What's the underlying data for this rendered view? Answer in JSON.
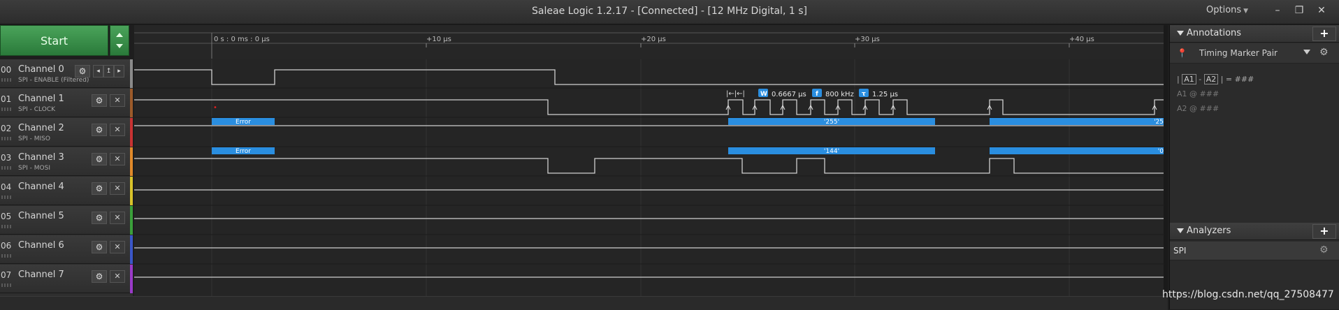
{
  "window": {
    "title": "Saleae Logic 1.2.17 - [Connected] - [12 MHz Digital, 1 s]",
    "options_label": "Options",
    "min_glyph": "–",
    "restore_glyph": "❐",
    "close_glyph": "✕"
  },
  "start_button": {
    "label": "Start"
  },
  "ruler": {
    "origin_label": "0 s : 0 ms : 0 μs",
    "ticks": [
      "+10 μs",
      "+20 μs",
      "+30 μs",
      "+40 μs"
    ]
  },
  "channels": [
    {
      "num": "00",
      "name": "Channel 0",
      "sub": "SPI - ENABLE (Filtered)",
      "color": "#8a8a8a"
    },
    {
      "num": "01",
      "name": "Channel 1",
      "sub": "SPI - CLOCK",
      "color": "#9c5a2a"
    },
    {
      "num": "02",
      "name": "Channel 2",
      "sub": "SPI - MISO",
      "color": "#c83232"
    },
    {
      "num": "03",
      "name": "Channel 3",
      "sub": "SPI - MOSI",
      "color": "#e0892a"
    },
    {
      "num": "04",
      "name": "Channel 4",
      "sub": "",
      "color": "#d8c22a"
    },
    {
      "num": "05",
      "name": "Channel 5",
      "sub": "",
      "color": "#3aa03a"
    },
    {
      "num": "06",
      "name": "Channel 6",
      "sub": "",
      "color": "#3a56c8"
    },
    {
      "num": "07",
      "name": "Channel 7",
      "sub": "",
      "color": "#9a3ac8"
    }
  ],
  "measurement": {
    "width": "0.6667 μs",
    "freq": "800 kHz",
    "period": "1.25 μs",
    "w_badge": "W",
    "f_badge": "f",
    "t_badge": "τ"
  },
  "decoded": {
    "miso_error": "Error",
    "miso_byte1": "'255'",
    "miso_byte2": "'25",
    "mosi_error": "Error",
    "mosi_byte1": "'144'",
    "mosi_byte2": "'0"
  },
  "annotations": {
    "header": "Annotations",
    "marker_pair": "Timing Marker Pair",
    "a1": "A1",
    "a2": "A2",
    "value": "###",
    "a1_at": "A1 @ ###",
    "a2_at": "A2 @ ###"
  },
  "analyzers": {
    "header": "Analyzers",
    "items": [
      "SPI"
    ]
  },
  "watermark": "https://blog.csdn.net/qq_27508477",
  "colors": {
    "accent_green": "#3a8f4a",
    "decode_blue": "#2a8ee0",
    "wave": "#d0d0d0"
  }
}
